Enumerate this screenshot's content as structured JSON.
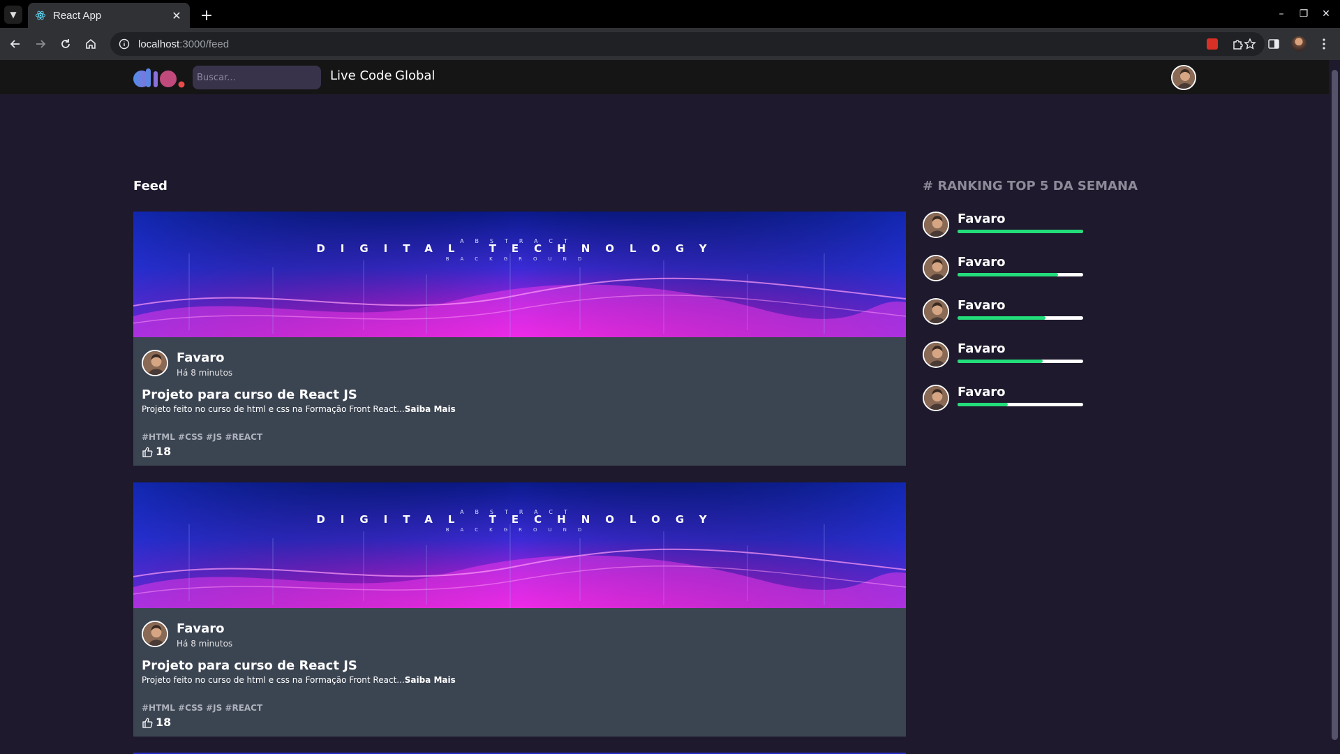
{
  "browser": {
    "tab_title": "React App",
    "url_host": "localhost",
    "url_path": ":3000/feed"
  },
  "header": {
    "search_placeholder": "Buscar...",
    "nav": [
      "Live Code",
      "Global"
    ]
  },
  "feed": {
    "title": "Feed",
    "posts": [
      {
        "banner_title": "DIGITAL TECHNOLOGY",
        "banner_top": "ABSTRACT",
        "banner_bottom": "BACKGROUND",
        "author": "Favaro",
        "time": "Há 8 minutos",
        "title": "Projeto para curso de React JS",
        "description": "Projeto feito no curso de html e css na Formação Front React...",
        "more": "Saiba Mais",
        "tags": "#HTML #CSS #JS #REACT",
        "likes": "18"
      },
      {
        "banner_title": "DIGITAL TECHNOLOGY",
        "banner_top": "ABSTRACT",
        "banner_bottom": "BACKGROUND",
        "author": "Favaro",
        "time": "Há 8 minutos",
        "title": "Projeto para curso de React JS",
        "description": "Projeto feito no curso de html e css na Formação Front React...",
        "more": "Saiba Mais",
        "tags": "#HTML #CSS #JS #REACT",
        "likes": "18"
      }
    ]
  },
  "ranking": {
    "title": "# RANKING TOP 5 DA SEMANA",
    "items": [
      {
        "name": "Favaro",
        "progress": 1.0
      },
      {
        "name": "Favaro",
        "progress": 0.8
      },
      {
        "name": "Favaro",
        "progress": 0.7
      },
      {
        "name": "Favaro",
        "progress": 0.68
      },
      {
        "name": "Favaro",
        "progress": 0.4
      }
    ]
  },
  "colors": {
    "page_bg": "#1e192c",
    "header_bg": "#151515",
    "card_bg": "#3b4451",
    "progress": "#23dd7a"
  }
}
